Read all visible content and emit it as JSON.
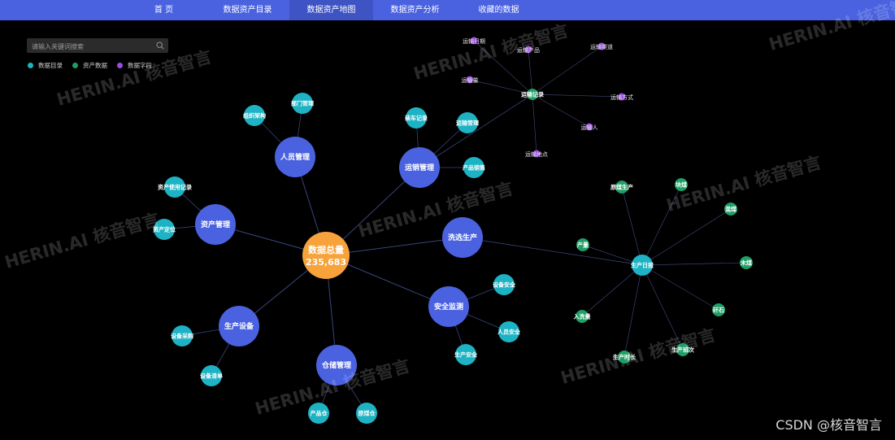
{
  "nav": {
    "items": [
      {
        "label": "首 页"
      },
      {
        "label": "数据资产目录"
      },
      {
        "label": "数据资产地图",
        "active": true
      },
      {
        "label": "数据资产分析"
      },
      {
        "label": "收藏的数据"
      }
    ]
  },
  "search": {
    "placeholder": "请输入关键词搜索"
  },
  "legend": [
    {
      "label": "数据目录",
      "color": "#1eb3c4"
    },
    {
      "label": "资产数据",
      "color": "#1f9e66"
    },
    {
      "label": "数据字段",
      "color": "#9b4be0"
    }
  ],
  "graph": {
    "root": {
      "label": "数据总量",
      "value": "235,683",
      "color": "#f7a23b"
    },
    "colors": {
      "category": "#4a62e0",
      "catalog": "#1eb3c4",
      "asset": "#1f9e66",
      "field": "#9b4be0"
    },
    "categories": [
      {
        "id": "renyuan",
        "label": "人员管理",
        "children": [
          "组织架构",
          "部门管理"
        ]
      },
      {
        "id": "yunxiao",
        "label": "运销管理",
        "children": [
          "装车记录",
          "运输管理",
          "产品销售"
        ]
      },
      {
        "id": "zichan",
        "label": "资产管理",
        "children": [
          "资产使用记录",
          "资产定位"
        ]
      },
      {
        "id": "xixuan",
        "label": "洗选生产",
        "children": []
      },
      {
        "id": "anquan",
        "label": "安全监测",
        "children": [
          "设备安全",
          "人员安全",
          "生产安全"
        ]
      },
      {
        "id": "shebei",
        "label": "生产设备",
        "children": [
          "设备采购",
          "设备清单"
        ]
      },
      {
        "id": "cangchu",
        "label": "仓储管理",
        "children": [
          "产品仓",
          "原煤仓"
        ]
      }
    ],
    "asset_groups": [
      {
        "label": "运输记录",
        "fields": [
          "运输日期",
          "运输产品",
          "运输渠道",
          "运输量",
          "运输方式",
          "运输人",
          "运输地点"
        ]
      },
      {
        "label": "生产日报",
        "fields": [
          "原煤生产",
          "块煤",
          "混煤",
          "产量",
          "末煤",
          "矸石",
          "入洗量",
          "生产时长",
          "生产班次"
        ]
      }
    ]
  },
  "watermark": "HERIN.AI 核音智言",
  "credit": "CSDN @核音智言"
}
